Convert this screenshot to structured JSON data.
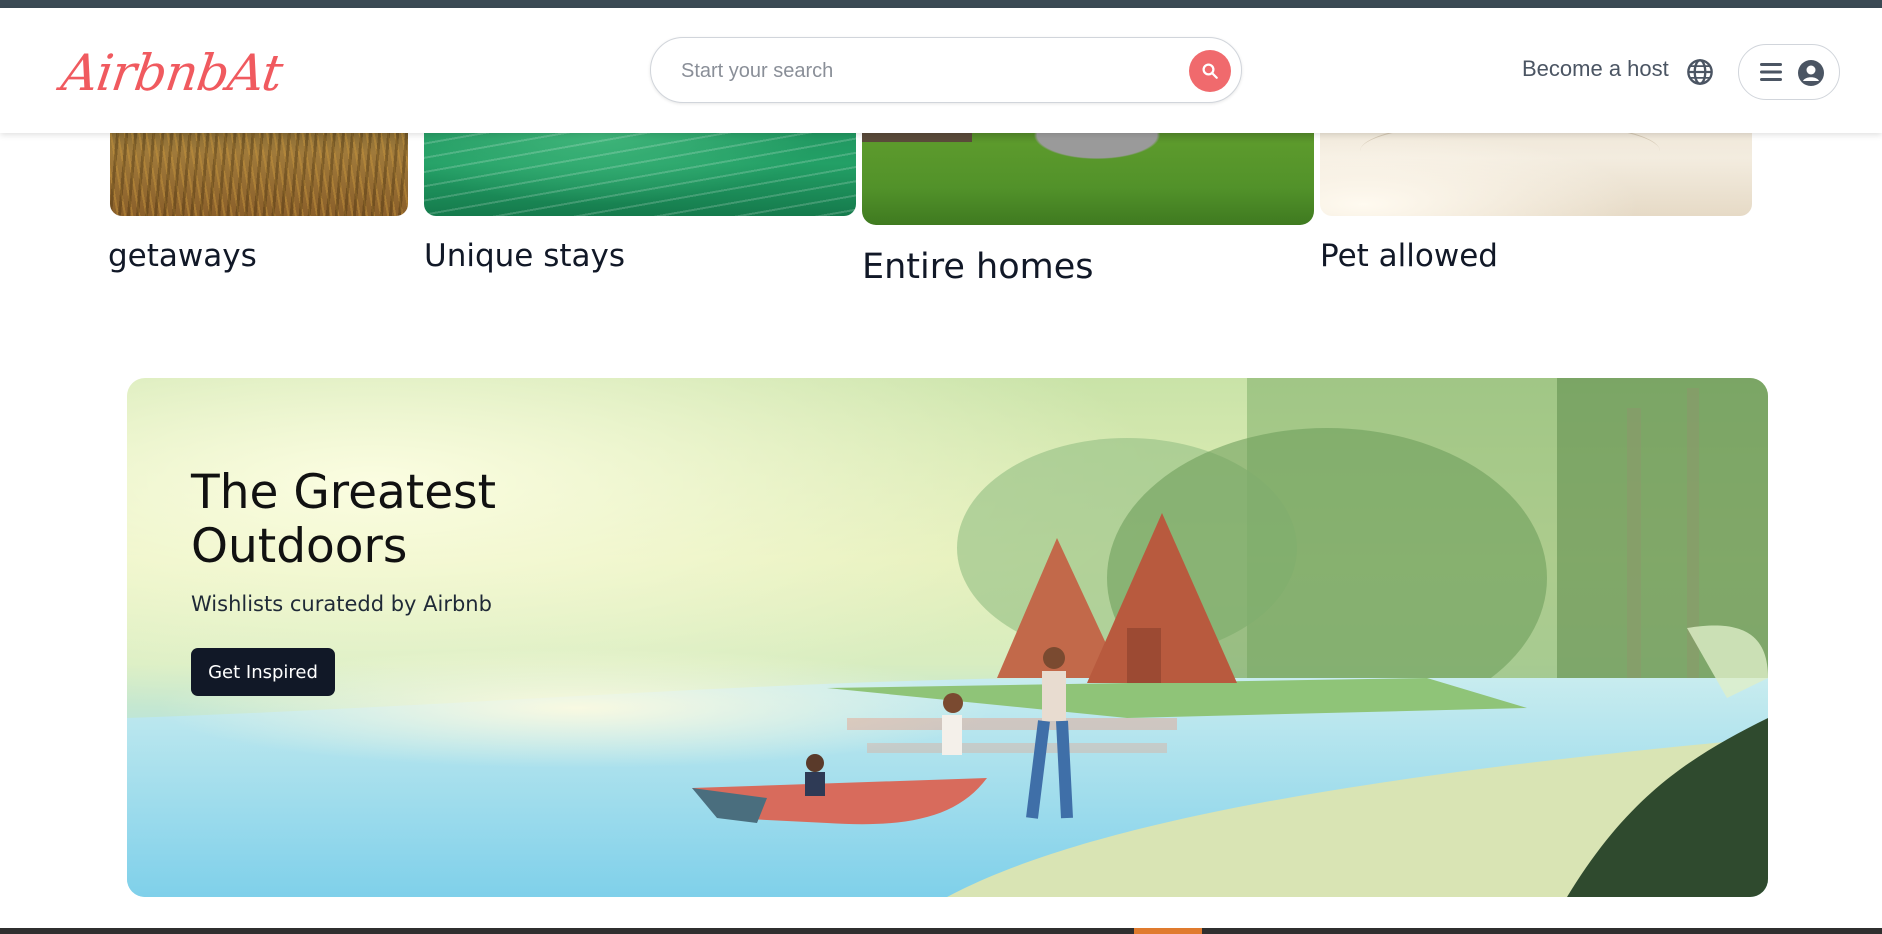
{
  "header": {
    "logo": "AirbnbAt",
    "search": {
      "placeholder": "Start your search",
      "value": ""
    },
    "become_host": "Become a host",
    "icons": {
      "search": "search-icon",
      "globe": "globe-icon",
      "menu": "menu-icon",
      "avatar": "user-avatar-icon"
    },
    "accent_color": "#f06a6d"
  },
  "categories": [
    {
      "label": "getaways"
    },
    {
      "label": "Unique stays"
    },
    {
      "label": "Entire homes"
    },
    {
      "label": "Pet allowed"
    }
  ],
  "banner": {
    "title": "The Greatest Outdoors",
    "subtitle": "Wishlists curatedd by Airbnb",
    "button": "Get Inspired"
  }
}
